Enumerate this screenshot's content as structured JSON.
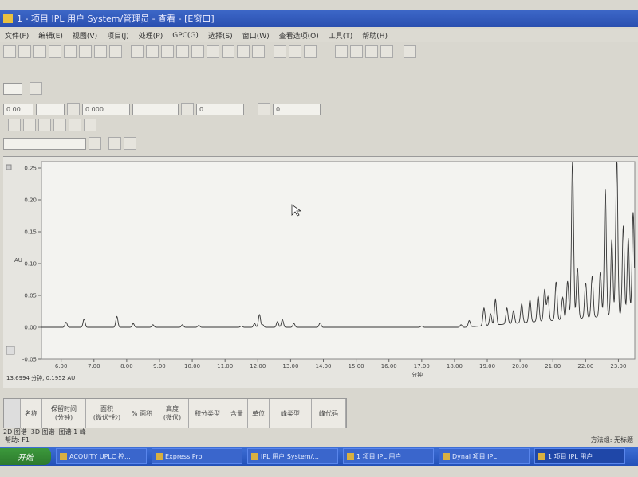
{
  "window": {
    "title": "1 - 项目 IPL 用户 System/管理员 - 查看 - [E窗口]"
  },
  "menu": [
    "文件(F)",
    "编辑(E)",
    "视图(V)",
    "项目(J)",
    "处理(P)",
    "GPC(G)",
    "选择(S)",
    "窗口(W)",
    "查看选项(O)",
    "工具(T)",
    "帮助(H)"
  ],
  "toolbar": {
    "start_field": "0.00",
    "end_field": "0.000",
    "field3": "0",
    "field4": "0"
  },
  "chart_data": {
    "type": "line",
    "xlabel": "分钟",
    "ylabel": "AU",
    "xlim": [
      5.4,
      23.5
    ],
    "ylim": [
      -0.05,
      0.26
    ],
    "x_ticks": [
      "6.00",
      "7.00",
      "8.00",
      "9.00",
      "10.00",
      "11.00",
      "12.00",
      "13.00",
      "14.00",
      "15.00",
      "16.00",
      "17.00",
      "18.00",
      "19.00",
      "20.00",
      "21.00",
      "22.00",
      "23.00"
    ],
    "y_ticks": [
      "-0.05",
      "0.00",
      "0.05",
      "0.10",
      "0.15",
      "0.20",
      "0.25"
    ],
    "cursor_readout": "13.6994 分钟, 0.1952 AU",
    "baseline": 0.0,
    "peaks": [
      {
        "x": 6.15,
        "y": 0.008
      },
      {
        "x": 6.7,
        "y": 0.013
      },
      {
        "x": 7.7,
        "y": 0.017
      },
      {
        "x": 8.2,
        "y": 0.006
      },
      {
        "x": 8.8,
        "y": 0.004
      },
      {
        "x": 9.7,
        "y": 0.004
      },
      {
        "x": 10.2,
        "y": 0.003
      },
      {
        "x": 11.5,
        "y": 0.002
      },
      {
        "x": 11.9,
        "y": 0.006
      },
      {
        "x": 12.05,
        "y": 0.02
      },
      {
        "x": 12.15,
        "y": 0.004
      },
      {
        "x": 12.6,
        "y": 0.009
      },
      {
        "x": 12.75,
        "y": 0.012
      },
      {
        "x": 13.1,
        "y": 0.006
      },
      {
        "x": 13.9,
        "y": 0.007
      },
      {
        "x": 17.0,
        "y": 0.002
      },
      {
        "x": 18.2,
        "y": 0.004
      },
      {
        "x": 18.45,
        "y": 0.01
      },
      {
        "x": 18.9,
        "y": 0.028
      },
      {
        "x": 19.1,
        "y": 0.018
      },
      {
        "x": 19.25,
        "y": 0.04
      },
      {
        "x": 19.6,
        "y": 0.025
      },
      {
        "x": 19.8,
        "y": 0.02
      },
      {
        "x": 20.05,
        "y": 0.03
      },
      {
        "x": 20.3,
        "y": 0.035
      },
      {
        "x": 20.55,
        "y": 0.04
      },
      {
        "x": 20.75,
        "y": 0.05
      },
      {
        "x": 20.85,
        "y": 0.038
      },
      {
        "x": 21.1,
        "y": 0.06
      },
      {
        "x": 21.3,
        "y": 0.035
      },
      {
        "x": 21.45,
        "y": 0.06
      },
      {
        "x": 21.6,
        "y": 0.25
      },
      {
        "x": 21.75,
        "y": 0.08
      },
      {
        "x": 22.0,
        "y": 0.055
      },
      {
        "x": 22.2,
        "y": 0.065
      },
      {
        "x": 22.45,
        "y": 0.07
      },
      {
        "x": 22.6,
        "y": 0.2
      },
      {
        "x": 22.8,
        "y": 0.12
      },
      {
        "x": 22.95,
        "y": 0.25
      },
      {
        "x": 23.15,
        "y": 0.14
      },
      {
        "x": 23.3,
        "y": 0.12
      },
      {
        "x": 23.45,
        "y": 0.16
      }
    ]
  },
  "results_table": {
    "columns": [
      "名称",
      "保留时间\n(分钟)",
      "面积\n(微伏*秒)",
      "% 面积",
      "高度\n(微伏)",
      "积分类型",
      "含量",
      "单位",
      "峰类型",
      "峰代码"
    ]
  },
  "tabs": [
    "2D 图谱",
    "3D 图谱",
    "图谱 1 峰"
  ],
  "status": {
    "left": "帮助: F1",
    "right": "方法组: 无标题"
  },
  "taskbar": {
    "start": "开始",
    "items": [
      "ACQUITY UPLC 控...",
      "Express Pro",
      "IPL 用户 System/...",
      "1 项目 IPL 用户",
      "Dynal 项目 IPL",
      "1 项目 IPL 用户"
    ]
  }
}
